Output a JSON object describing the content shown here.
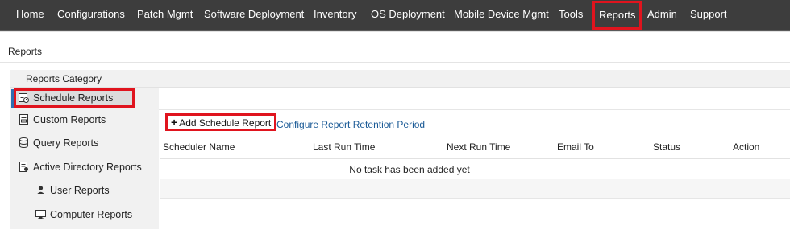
{
  "nav": {
    "items": [
      {
        "label": "Home"
      },
      {
        "label": "Configurations"
      },
      {
        "label": "Patch Mgmt"
      },
      {
        "label": "Software Deployment"
      },
      {
        "label": "Inventory"
      },
      {
        "label": "OS Deployment"
      },
      {
        "label": "Mobile Device Mgmt"
      },
      {
        "label": "Tools"
      },
      {
        "label": "Reports"
      },
      {
        "label": "Admin"
      },
      {
        "label": "Support"
      }
    ],
    "active": "Reports"
  },
  "page": {
    "title": "Reports"
  },
  "sidebar": {
    "category_label": "Reports Category",
    "items": [
      {
        "label": "Schedule Reports",
        "icon": "schedule-report-icon",
        "selected": true
      },
      {
        "label": "Custom Reports",
        "icon": "custom-report-icon"
      },
      {
        "label": "Query Reports",
        "icon": "database-icon"
      },
      {
        "label": "Active Directory Reports",
        "icon": "directory-report-icon"
      },
      {
        "label": "User Reports",
        "icon": "user-icon"
      },
      {
        "label": "Computer Reports",
        "icon": "monitor-icon"
      }
    ]
  },
  "toolbar": {
    "add_label": "Add Schedule Report",
    "retention_label": "Configure Report Retention Period"
  },
  "table": {
    "columns": [
      "Scheduler Name",
      "Last Run Time",
      "Next Run Time",
      "Email To",
      "Status",
      "Action"
    ],
    "empty_message": "No task has been added yet"
  },
  "colors": {
    "nav_bg": "#3d3d3d",
    "highlight": "#e0141e",
    "link": "#1a5a96",
    "sidebar_bg": "#f1f1f1"
  }
}
